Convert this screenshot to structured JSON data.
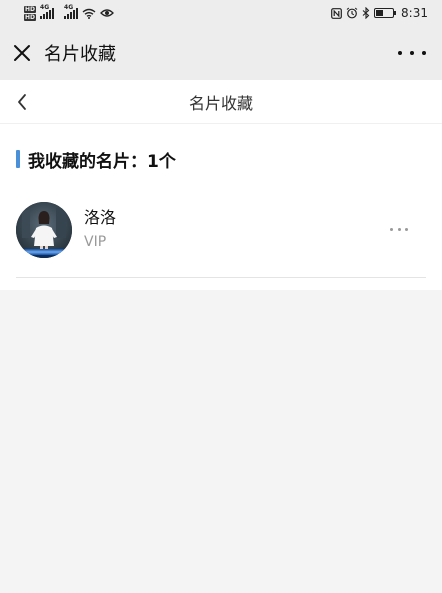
{
  "status_bar": {
    "hd1": "HD",
    "hd2": "HD",
    "net1": "4G",
    "net2": "4G",
    "nfc_icon": "nfc-icon",
    "alarm_icon": "alarm-icon",
    "bluetooth_icon": "bluetooth-icon",
    "battery_level": 0.45,
    "time": "8:31"
  },
  "app_bar": {
    "title": "名片收藏",
    "close_icon": "close-icon",
    "more_icon": "more-icon"
  },
  "page_header": {
    "title": "名片收藏",
    "back_icon": "chevron-left-icon"
  },
  "section": {
    "title": "我收藏的名片：1个",
    "accent_color": "#4a90d9"
  },
  "cards": [
    {
      "name": "洛洛",
      "level": "VIP",
      "more_icon": "more-icon"
    }
  ]
}
